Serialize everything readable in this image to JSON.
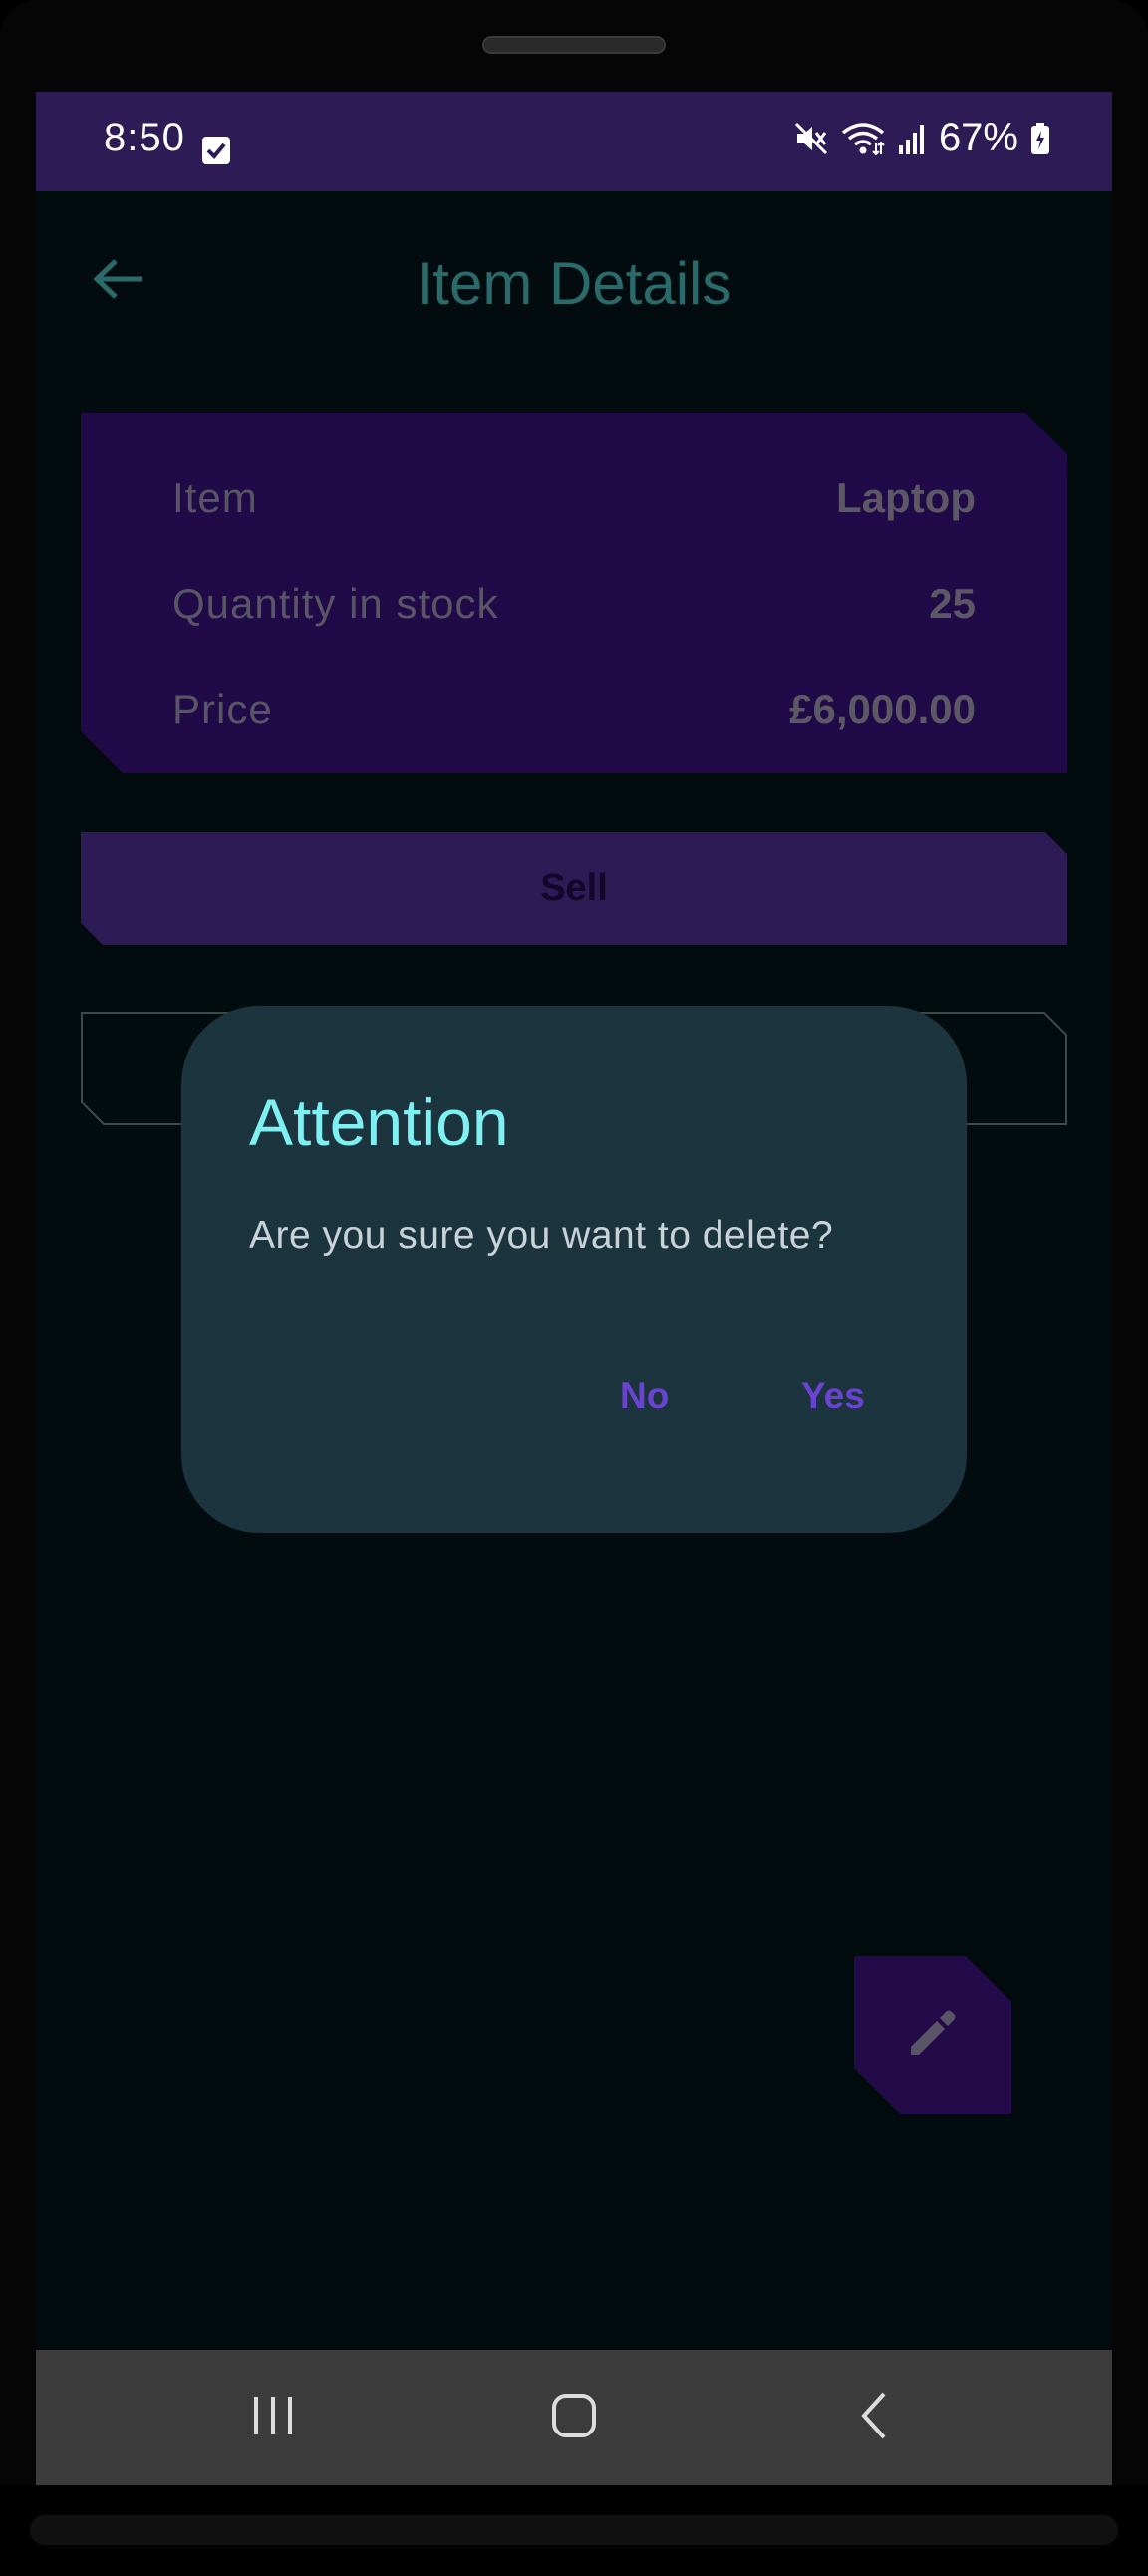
{
  "status_bar": {
    "time": "8:50",
    "battery": "67%",
    "icons": [
      "checkbox-icon",
      "mute-icon",
      "wifi-icon",
      "signal-icon",
      "battery-icon"
    ]
  },
  "app_bar": {
    "title": "Item Details",
    "back_icon": "arrow-back-icon"
  },
  "details": {
    "item_label": "Item",
    "item_value": "Laptop",
    "quantity_label": "Quantity in stock",
    "quantity_value": "25",
    "price_label": "Price",
    "price_value": "£6,000.00"
  },
  "actions": {
    "sell_label": "Sell"
  },
  "dialog": {
    "title": "Attention",
    "message": "Are you sure you want to delete?",
    "no_label": "No",
    "yes_label": "Yes"
  },
  "fab": {
    "icon": "edit-pencil-icon"
  },
  "colors": {
    "status_bar": "#2d1b55",
    "background": "#020c0e",
    "card": "#200a47",
    "dialog_bg": "#1b343d",
    "dialog_title": "#7ff0f2",
    "dialog_button": "#6a44d0",
    "nav_bar": "#3c3c3c"
  }
}
